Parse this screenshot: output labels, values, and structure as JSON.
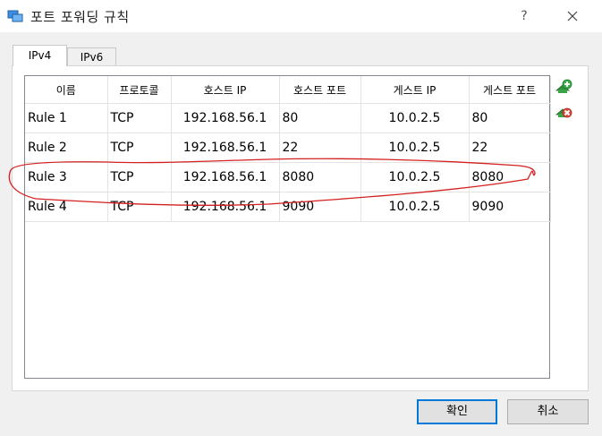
{
  "window": {
    "title": "포트 포워딩 규칙",
    "help": "?"
  },
  "tabs": [
    {
      "label": "IPv4",
      "active": true
    },
    {
      "label": "IPv6",
      "active": false
    }
  ],
  "table": {
    "columns": [
      "이름",
      "프로토콜",
      "호스트 IP",
      "호스트 포트",
      "게스트 IP",
      "게스트 포트"
    ],
    "rows": [
      [
        "Rule 1",
        "TCP",
        "192.168.56.1",
        "80",
        "10.0.2.5",
        "80"
      ],
      [
        "Rule 2",
        "TCP",
        "192.168.56.1",
        "22",
        "10.0.2.5",
        "22"
      ],
      [
        "Rule 3",
        "TCP",
        "192.168.56.1",
        "8080",
        "10.0.2.5",
        "8080"
      ],
      [
        "Rule 4",
        "TCP",
        "192.168.56.1",
        "9090",
        "10.0.2.5",
        "9090"
      ]
    ]
  },
  "side_buttons": {
    "add_icon": "add-rule-icon",
    "remove_icon": "remove-rule-icon"
  },
  "buttons": {
    "ok": "확인",
    "cancel": "취소"
  },
  "colors": {
    "annotation": "#d42020",
    "accent": "#0078d7"
  }
}
